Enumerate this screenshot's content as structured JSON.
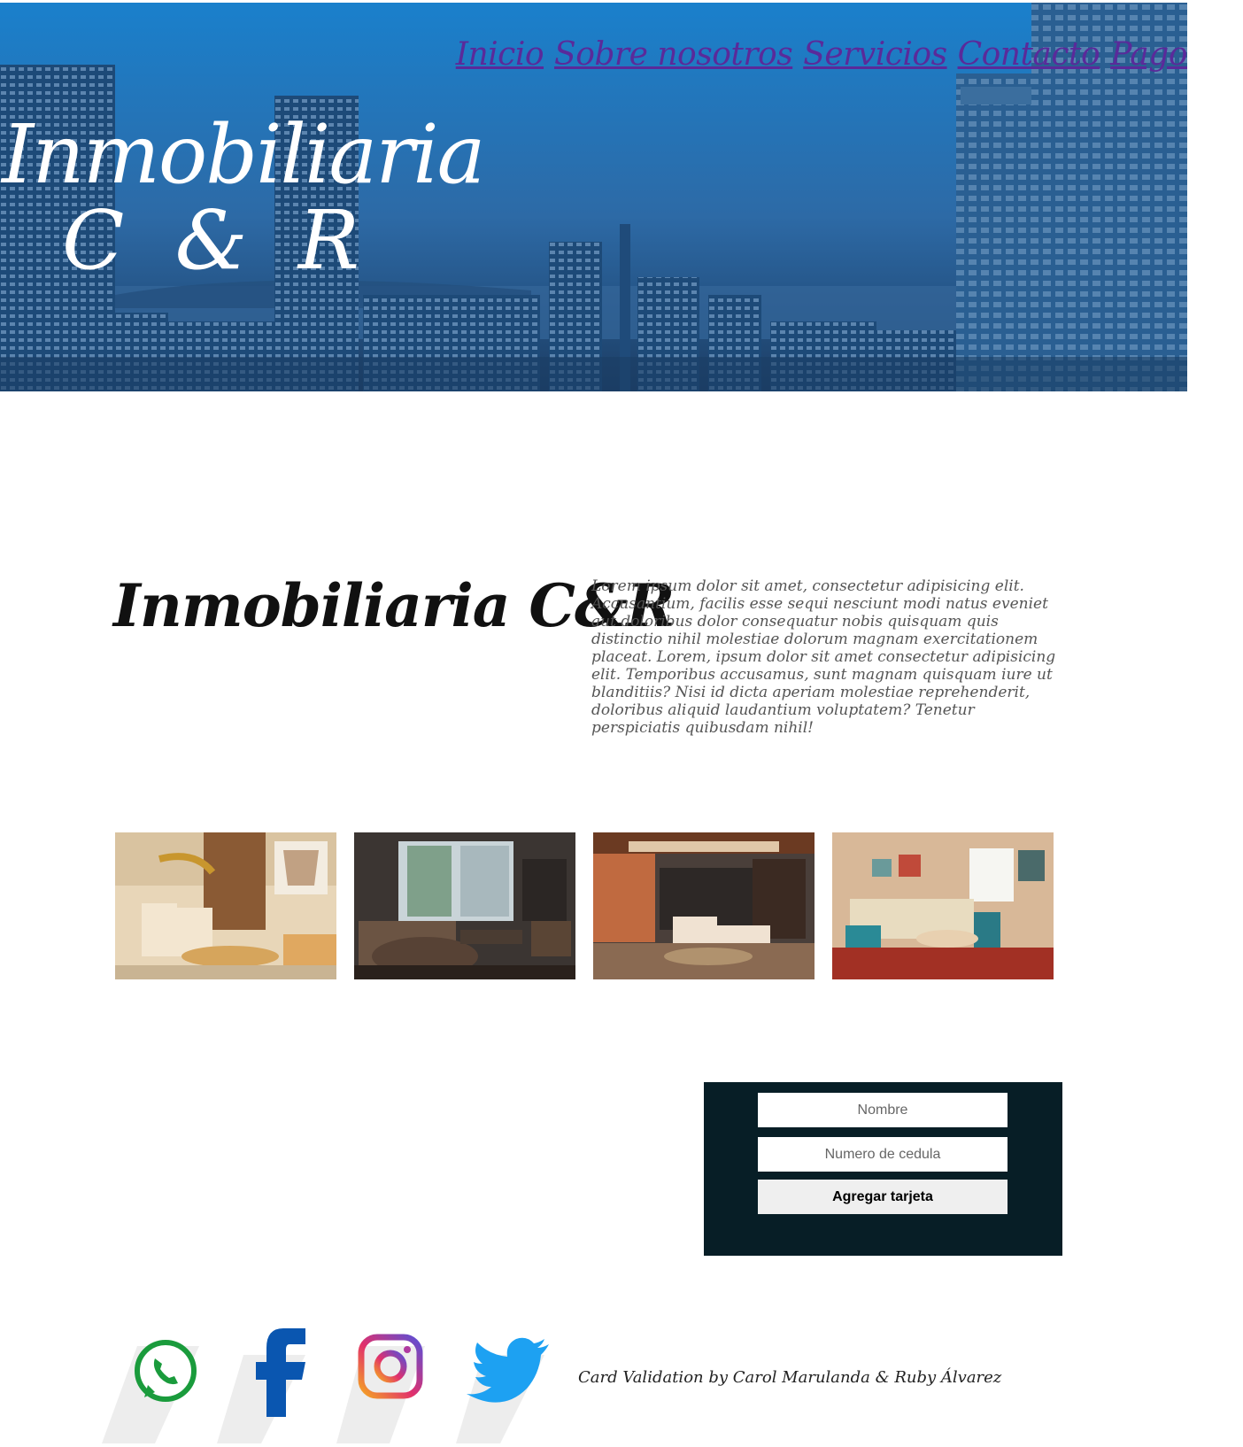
{
  "nav": {
    "items": [
      {
        "label": "Inicio"
      },
      {
        "label": "Sobre nosotros"
      },
      {
        "label": "Servicios"
      },
      {
        "label": "Contacto"
      },
      {
        "label": "Pago"
      }
    ],
    "link_color": "#5a2a9a"
  },
  "hero": {
    "title_line1": "Inmobiliaria",
    "title_line2": "C & R"
  },
  "intro": {
    "title": "Inmobiliaria C&R",
    "paragraph": "Lorem ipsum dolor sit amet, consectetur adipisicing elit. Accusantium, facilis esse sequi nesciunt modi natus eveniet aut doloribus dolor consequatur nobis quisquam quis distinctio nihil molestiae dolorum magnam exercitationem placeat. Lorem, ipsum dolor sit amet consectetur adipisicing elit. Temporibus accusamus, sunt magnam quisquam iure ut blanditiis? Nisi id dicta aperiam molestiae reprehenderit, doloribus aliquid laudantium voluptatem? Tenetur perspiciatis quibusdam nihil!"
  },
  "gallery": {
    "photos": [
      {
        "icon": "living-room-photo-1"
      },
      {
        "icon": "living-room-photo-2"
      },
      {
        "icon": "living-room-photo-3"
      },
      {
        "icon": "living-room-photo-4"
      }
    ]
  },
  "form": {
    "name_placeholder": "Nombre",
    "id_placeholder": "Numero de cedula",
    "submit_label": "Agregar tarjeta",
    "background": "#071e26"
  },
  "footer": {
    "social": [
      {
        "icon": "whatsapp-icon",
        "color": "#1a9b3c"
      },
      {
        "icon": "facebook-icon",
        "color": "#0a56b0"
      },
      {
        "icon": "instagram-icon",
        "color": "#c13584"
      },
      {
        "icon": "twitter-icon",
        "color": "#1da1f2"
      }
    ],
    "credit": "Card Validation by Carol Marulanda & Ruby Álvarez"
  }
}
